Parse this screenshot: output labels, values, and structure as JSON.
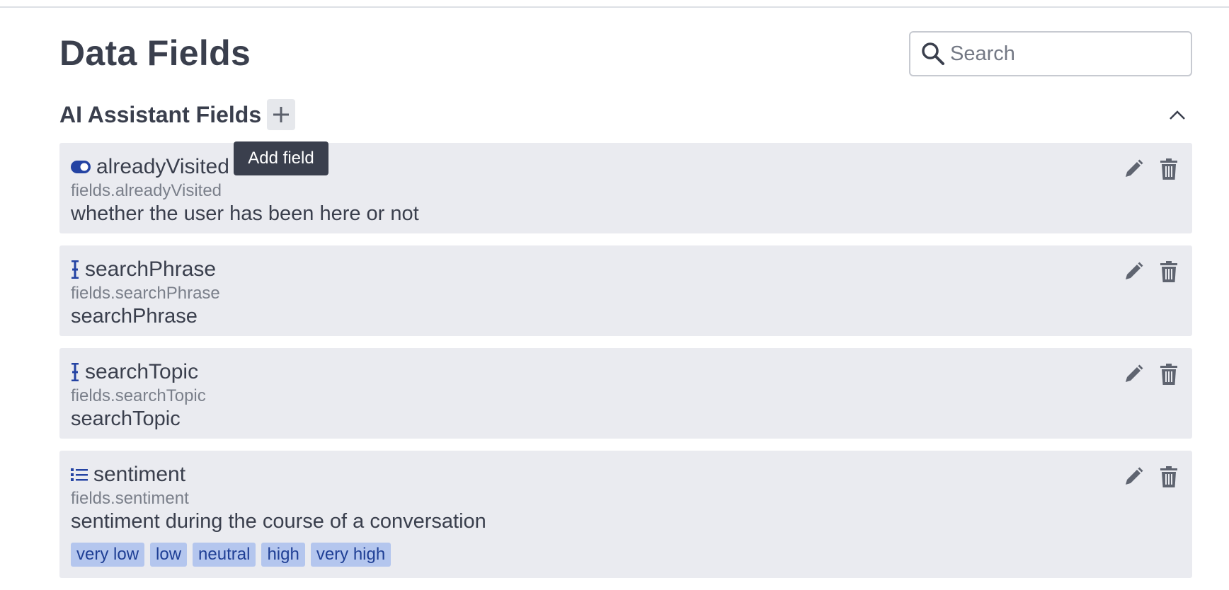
{
  "page": {
    "title": "Data Fields"
  },
  "search": {
    "placeholder": "Search",
    "value": ""
  },
  "section": {
    "title": "AI Assistant Fields",
    "tooltip": "Add field",
    "add_icon": "plus-icon",
    "collapse_icon": "chevron-up-icon"
  },
  "colors": {
    "accent": "#2443a3",
    "tag_bg": "#b4c6ee",
    "card_bg": "#eaebf0",
    "text": "#3a3f4d"
  },
  "fields": [
    {
      "icon": "toggle-icon",
      "name": "alreadyVisited",
      "path": "fields.alreadyVisited",
      "description": "whether the user has been here or not"
    },
    {
      "icon": "text-cursor-icon",
      "name": "searchPhrase",
      "path": "fields.searchPhrase",
      "description": "searchPhrase"
    },
    {
      "icon": "text-cursor-icon",
      "name": "searchTopic",
      "path": "fields.searchTopic",
      "description": "searchTopic"
    },
    {
      "icon": "list-icon",
      "name": "sentiment",
      "path": "fields.sentiment",
      "description": "sentiment during the course of a conversation",
      "options": [
        "very low",
        "low",
        "neutral",
        "high",
        "very high"
      ]
    }
  ]
}
